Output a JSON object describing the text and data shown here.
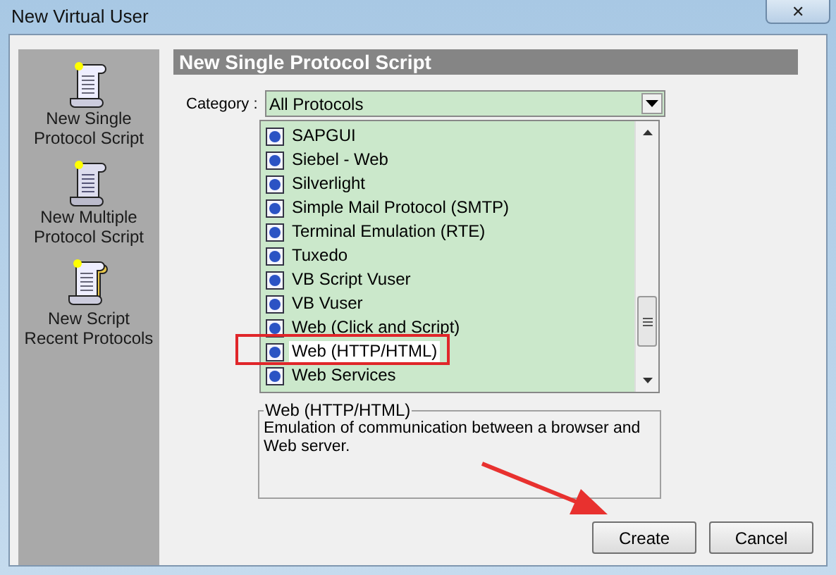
{
  "window": {
    "title": "New Virtual User",
    "close": "✕"
  },
  "sidebar": {
    "items": [
      {
        "label": "New Single Protocol Script",
        "kind": "single"
      },
      {
        "label": "New Multiple Protocol Script",
        "kind": "multiple"
      },
      {
        "label": "New Script Recent Protocols",
        "kind": "recent"
      }
    ]
  },
  "panel": {
    "title": "New Single Protocol Script",
    "category_label": "Category :",
    "category": "All Protocols",
    "protocols": [
      {
        "label": "SAPGUI",
        "selected": false,
        "highlighted": false
      },
      {
        "label": "Siebel - Web",
        "selected": false,
        "highlighted": false
      },
      {
        "label": "Silverlight",
        "selected": false,
        "highlighted": false
      },
      {
        "label": "Simple Mail Protocol (SMTP)",
        "selected": false,
        "highlighted": false
      },
      {
        "label": "Terminal Emulation (RTE)",
        "selected": false,
        "highlighted": false
      },
      {
        "label": "Tuxedo",
        "selected": false,
        "highlighted": false
      },
      {
        "label": "VB Script Vuser",
        "selected": false,
        "highlighted": false
      },
      {
        "label": "VB Vuser",
        "selected": false,
        "highlighted": false
      },
      {
        "label": "Web (Click and Script)",
        "selected": false,
        "highlighted": false
      },
      {
        "label": "Web (HTTP/HTML)",
        "selected": true,
        "highlighted": true
      },
      {
        "label": "Web Services",
        "selected": false,
        "highlighted": false
      }
    ],
    "description": {
      "legend": "Web (HTTP/HTML)",
      "text": "Emulation of communication between a browser and Web server."
    }
  },
  "buttons": [
    "Create",
    "Cancel"
  ]
}
